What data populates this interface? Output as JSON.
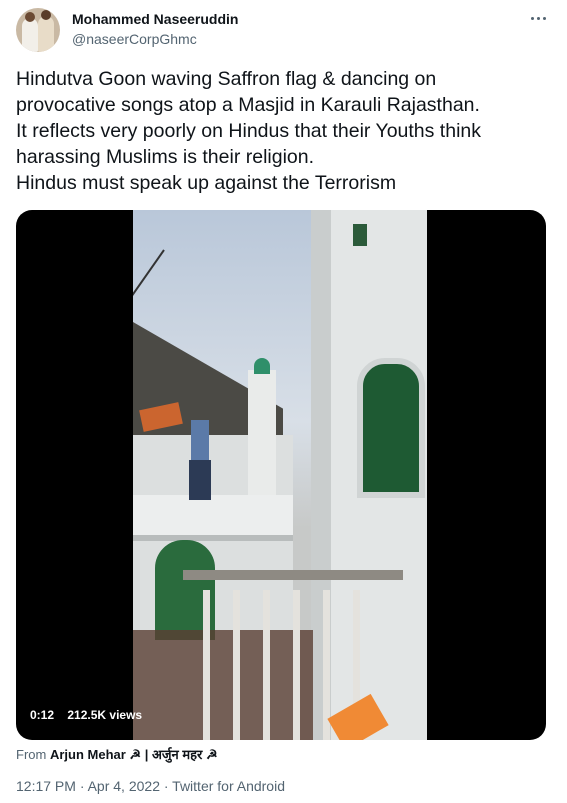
{
  "author": {
    "name": "Mohammed Naseeruddin",
    "handle": "@naseerCorpGhmc"
  },
  "tweet": {
    "text": "Hindutva Goon waving Saffron flag & dancing on\nprovocative songs atop a Masjid in Karauli Rajasthan.\nIt reflects very poorly on Hindus that their Youths think\nharassing Muslims is their religion.\nHindus must speak up against the Terrorism"
  },
  "video": {
    "duration": "0:12",
    "views": "212.5K views"
  },
  "attribution": {
    "prefix": "From",
    "source": "Arjun Mehar ☭ | अर्जुन महर ☭"
  },
  "meta": {
    "line": "12:17 PM · Apr 4, 2022 · Twitter for Android"
  },
  "icons": [
    "more-options-icon"
  ]
}
